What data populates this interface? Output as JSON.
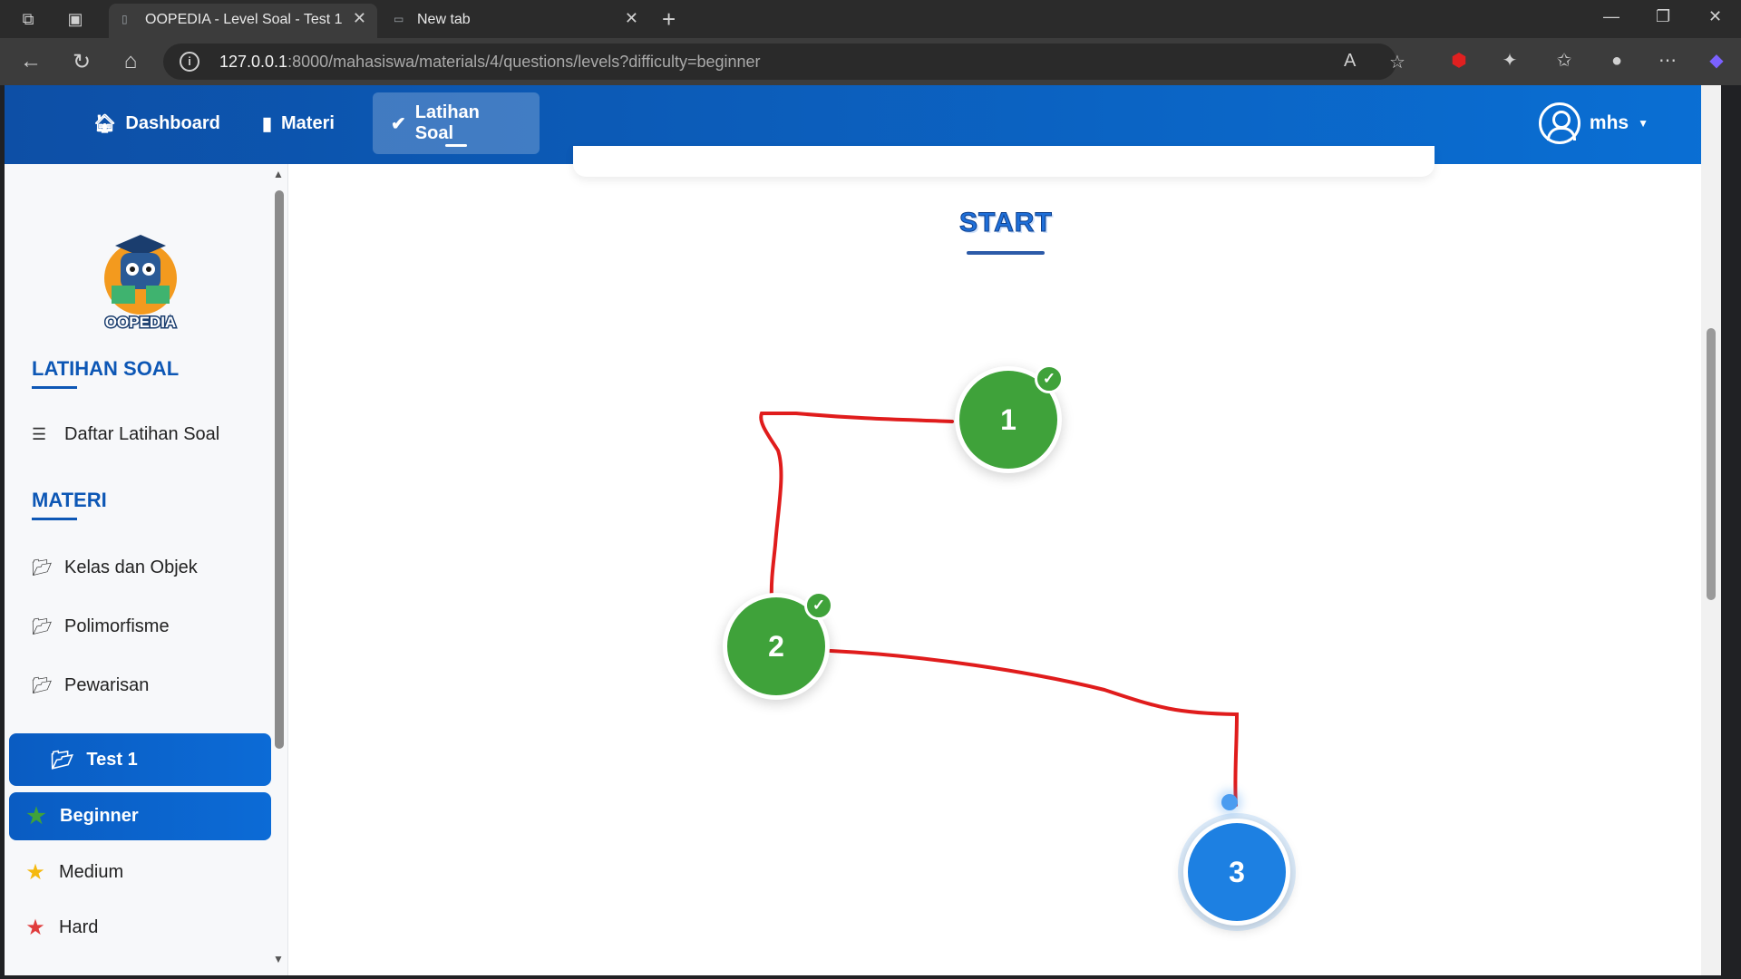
{
  "browser": {
    "tabs": [
      {
        "title": "OOPEDIA - Level Soal - Test 1",
        "active": true
      },
      {
        "title": "New tab",
        "active": false
      }
    ],
    "url_host": "127.0.0.1",
    "url_rest": ":8000/mahasiswa/materials/4/questions/levels?difficulty=beginner"
  },
  "navbar": {
    "links": [
      {
        "label": "Dashboard",
        "icon": "home-icon",
        "active": false
      },
      {
        "label": "Materi",
        "icon": "book-icon",
        "active": false
      },
      {
        "label": "Latihan Soal",
        "icon": "clipboard-check-icon",
        "active": true
      }
    ],
    "user": "mhs",
    "accent": "#0a6fd4"
  },
  "sidebar": {
    "logo_text": "OOPEDIA",
    "section_latihan": "LATIHAN SOAL",
    "daftar_latihan": "Daftar Latihan Soal",
    "section_materi": "MATERI",
    "materi_items": [
      "Kelas dan Objek",
      "Polimorfisme",
      "Pewarisan",
      "Test 1"
    ],
    "active_materi": "Test 1",
    "levels": [
      {
        "label": "Beginner",
        "color": "#3fa23a",
        "active": true
      },
      {
        "label": "Medium",
        "color": "#f5b90f",
        "active": false
      },
      {
        "label": "Hard",
        "color": "#e03c3c",
        "active": false
      }
    ]
  },
  "main": {
    "start_label": "START",
    "nodes": [
      {
        "number": "1",
        "status": "completed"
      },
      {
        "number": "2",
        "status": "completed"
      },
      {
        "number": "3",
        "status": "current"
      }
    ],
    "colors": {
      "completed": "#3fa23a",
      "current": "#1d80e2",
      "path": "#e01c1c"
    }
  }
}
